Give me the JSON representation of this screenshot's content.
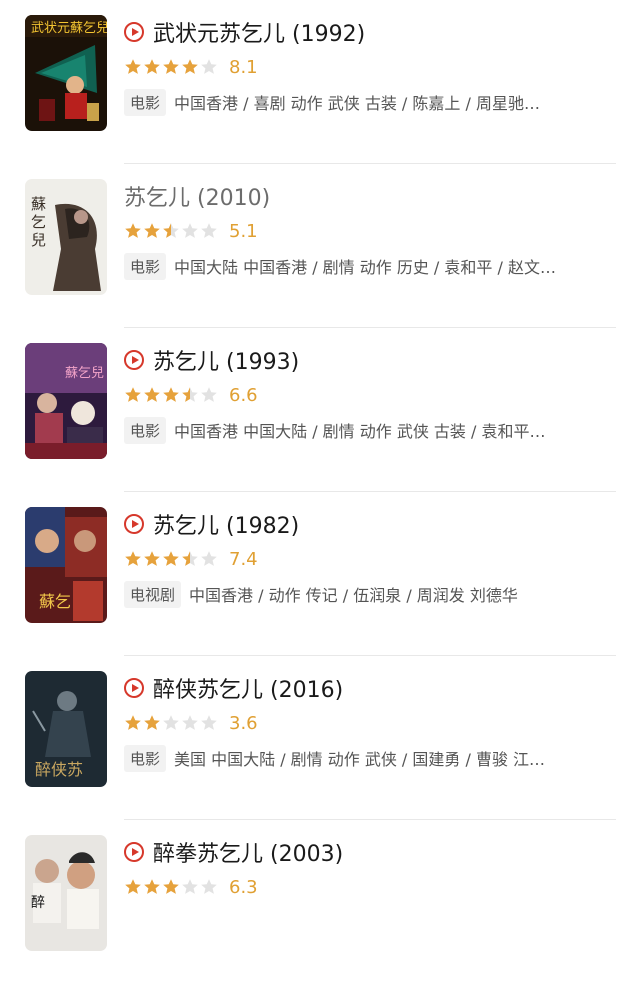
{
  "colors": {
    "play": "#d6382b",
    "star_on": "#e6a23c",
    "star_off": "#e2e2e2",
    "score": "#e0a033"
  },
  "items": [
    {
      "title": "武状元苏乞儿 (1992)",
      "playable": true,
      "stars": 4,
      "score": "8.1",
      "type": "电影",
      "meta": "中国香港 / 喜剧 动作 武侠 古装 / 陈嘉上 / 周星驰…",
      "poster_icon": "poster-image"
    },
    {
      "title": "苏乞儿 (2010)",
      "playable": false,
      "stars": 2.5,
      "score": "5.1",
      "type": "电影",
      "meta": "中国大陆 中国香港 / 剧情 动作 历史 / 袁和平 / 赵文…",
      "poster_icon": "poster-image"
    },
    {
      "title": "苏乞儿 (1993)",
      "playable": true,
      "stars": 3.5,
      "score": "6.6",
      "type": "电影",
      "meta": "中国香港 中国大陆 / 剧情 动作 武侠 古装 / 袁和平…",
      "poster_icon": "poster-image"
    },
    {
      "title": "苏乞儿 (1982)",
      "playable": true,
      "stars": 3.5,
      "score": "7.4",
      "type": "电视剧",
      "meta": "中国香港 / 动作 传记 / 伍润泉 / 周润发 刘德华",
      "poster_icon": "poster-image"
    },
    {
      "title": "醉侠苏乞儿 (2016)",
      "playable": true,
      "stars": 2,
      "score": "3.6",
      "type": "电影",
      "meta": "美国 中国大陆 / 剧情 动作 武侠 / 国建勇 / 曹骏 江…",
      "poster_icon": "poster-image"
    },
    {
      "title": "醉拳苏乞儿 (2003)",
      "playable": true,
      "stars": 3,
      "score": "6.3",
      "type": "",
      "meta": "",
      "poster_icon": "poster-image"
    }
  ]
}
